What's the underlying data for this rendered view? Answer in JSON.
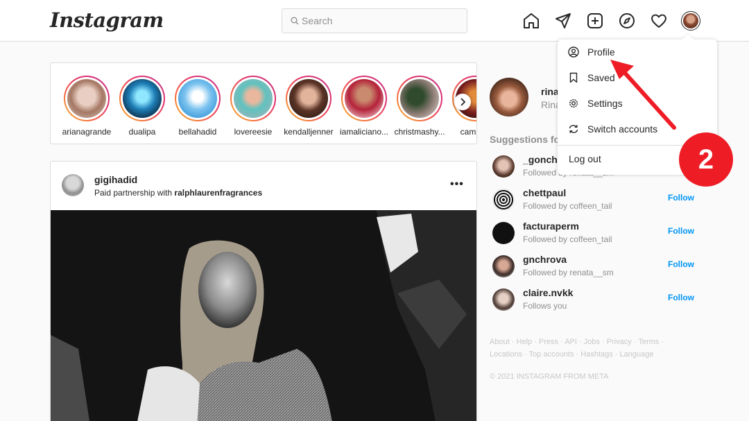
{
  "header": {
    "logo": "Instagram",
    "search_placeholder": "Search",
    "icons": [
      "home-icon",
      "direct-message-icon",
      "new-post-icon",
      "explore-icon",
      "activity-heart-icon",
      "profile-avatar"
    ]
  },
  "stories": {
    "items": [
      {
        "username": "arianagrande"
      },
      {
        "username": "dualipa"
      },
      {
        "username": "bellahadid"
      },
      {
        "username": "lovereesie"
      },
      {
        "username": "kendalljenner"
      },
      {
        "username": "iamaliciano..."
      },
      {
        "username": "christmashy..."
      },
      {
        "username": "cambria"
      }
    ],
    "next_icon": "chevron-right-icon"
  },
  "post": {
    "username": "gigihadid",
    "subtitle_prefix": "Paid partnership with ",
    "partner": "ralphlaurenfragrances",
    "more": "•••"
  },
  "sidebar": {
    "me": {
      "username": "rina",
      "fullname": "Rina"
    },
    "suggestions_title": "Suggestions for",
    "suggestions": [
      {
        "username": "_goncha",
        "sub": "Followed by renata__sm",
        "follow": ""
      },
      {
        "username": "chettpaul",
        "sub": "Followed by coffeen_tail",
        "follow": "Follow"
      },
      {
        "username": "facturaperm",
        "sub": "Followed by coffeen_tail",
        "follow": "Follow"
      },
      {
        "username": "gnchrova",
        "sub": "Followed by renata__sm",
        "follow": "Follow"
      },
      {
        "username": "claire.nvkk",
        "sub": "Follows you",
        "follow": "Follow"
      }
    ],
    "footer_links": "About · Help · Press · API · Jobs · Privacy · Terms · Locations · Top accounts · Hashtags · Language",
    "copyright": "© 2021 INSTAGRAM FROM META"
  },
  "dropdown": {
    "items": [
      {
        "label": "Profile",
        "icon": "profile-icon"
      },
      {
        "label": "Saved",
        "icon": "bookmark-icon"
      },
      {
        "label": "Settings",
        "icon": "settings-gear-icon"
      },
      {
        "label": "Switch accounts",
        "icon": "switch-accounts-icon"
      }
    ],
    "logout": "Log out"
  },
  "annotation": {
    "step": "2",
    "color": "#ee1c25"
  }
}
